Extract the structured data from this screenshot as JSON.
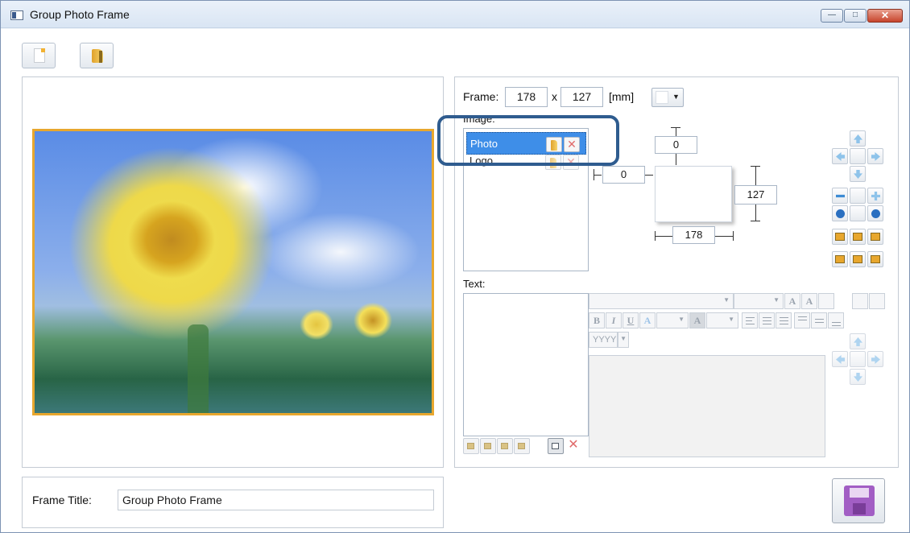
{
  "window": {
    "title": "Group Photo Frame",
    "min_glyph": "—",
    "max_glyph": "□",
    "close_glyph": "✕"
  },
  "frame": {
    "label": "Frame:",
    "width": "178",
    "times": "x",
    "height": "127",
    "unit": "[mm]"
  },
  "image": {
    "label": "Image:",
    "items": [
      {
        "name": "Photo"
      },
      {
        "name": "Logo"
      }
    ],
    "delete_glyph": "✕"
  },
  "position": {
    "top_offset": "0",
    "left_offset": "0",
    "width": "178",
    "height": "127"
  },
  "text": {
    "label": "Text:",
    "bold": "B",
    "italic": "I",
    "underline": "U",
    "font_color": "A",
    "bg_color": "A",
    "date_format": "YYYY",
    "delete_glyph": "✕"
  },
  "frame_title": {
    "label": "Frame Title:",
    "value": "Group Photo Frame"
  },
  "colors": {
    "accent": "#3e8ee8",
    "frame_border": "#e8a72e",
    "highlight": "#2f5c8f"
  },
  "icons": {
    "new": "new-document-icon",
    "open": "open-folder-icon",
    "save": "floppy-disk-save-icon"
  }
}
